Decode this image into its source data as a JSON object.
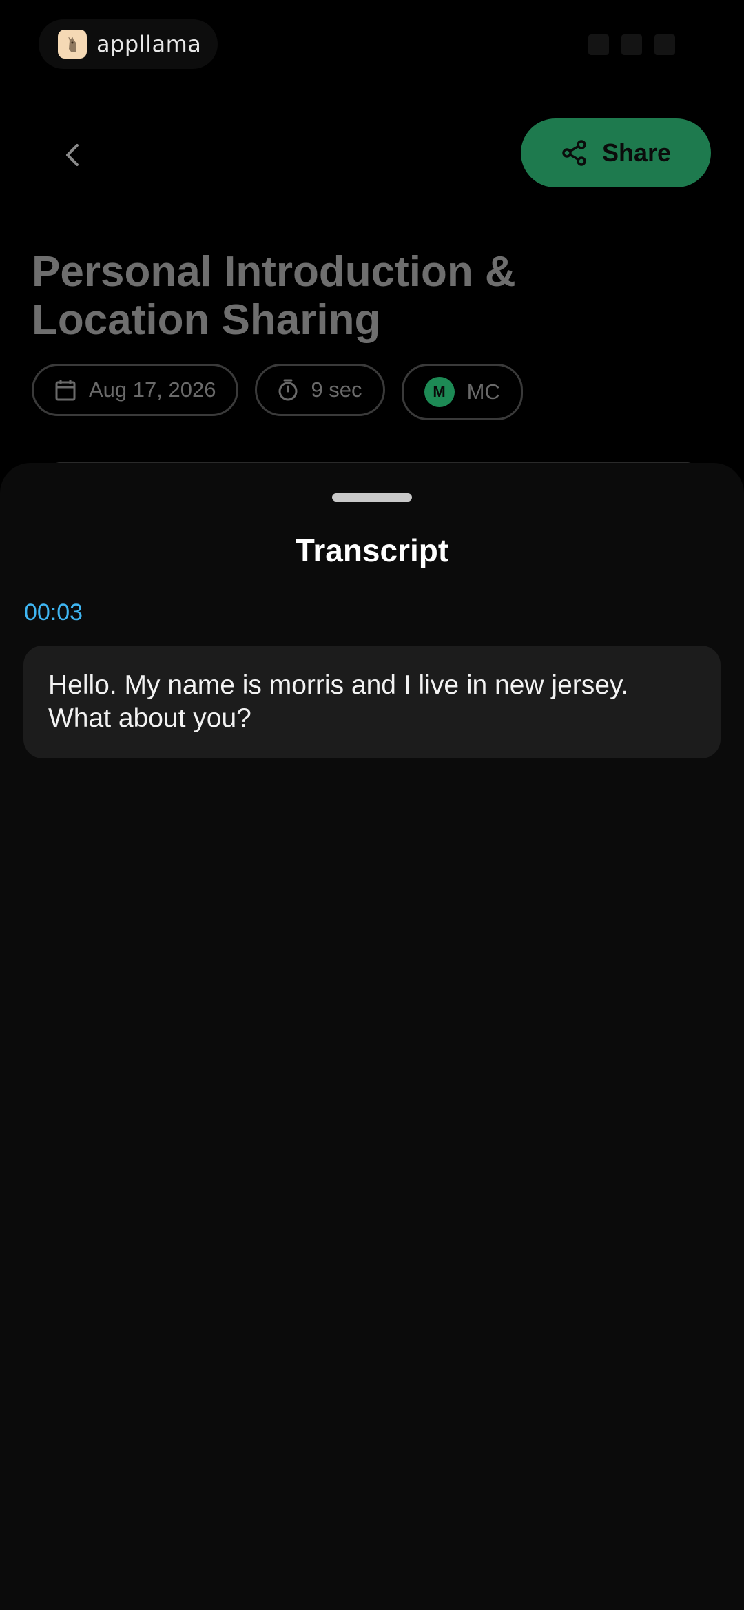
{
  "status_bar": {
    "brand_name": "appllama"
  },
  "header": {
    "back_icon": "chevron-left-icon",
    "share_label": "Share",
    "share_icon": "share-icon"
  },
  "recording": {
    "title": "Personal Introduction & Location Sharing",
    "date": "Aug 17, 2026",
    "duration": "9 sec",
    "speaker_initial": "M",
    "speaker_label": "MC"
  },
  "sheet": {
    "title": "Transcript",
    "segments": [
      {
        "timestamp": "00:03",
        "text": "Hello. My name is morris and I live in new jersey. What about you?"
      }
    ]
  },
  "colors": {
    "accent_green": "#1e7a4e",
    "timestamp_blue": "#3fb6f2",
    "sheet_bg": "#0b0b0b",
    "card_bg": "#1c1c1c"
  }
}
